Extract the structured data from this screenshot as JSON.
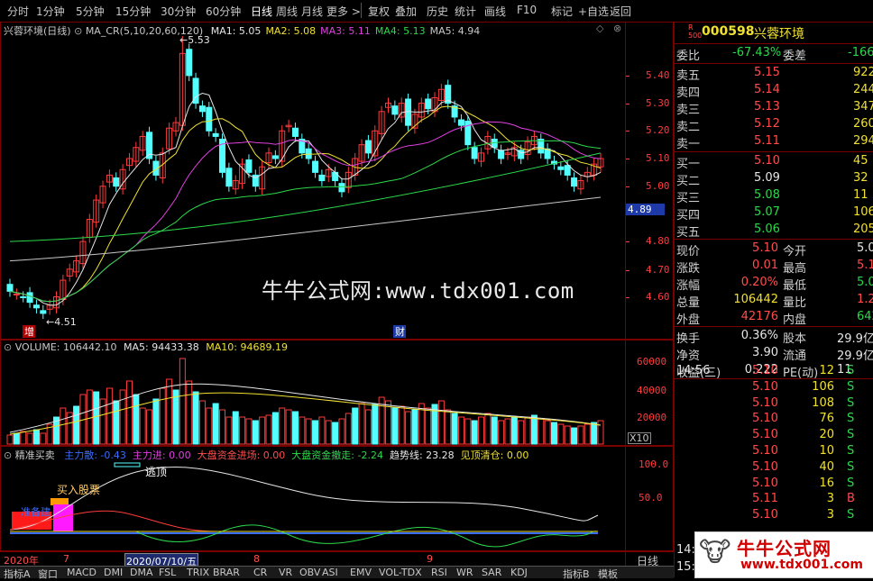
{
  "toolbar": {
    "periods": [
      "分时",
      "1分钟",
      "5分钟",
      "15分钟",
      "30分钟",
      "60分钟",
      "日线",
      "周线",
      "月线",
      "更多 >"
    ],
    "active_period": "日线",
    "actions": [
      "复权",
      "叠加",
      "历史",
      "统计",
      "画线",
      "F10",
      "标记",
      "+自选",
      "返回"
    ]
  },
  "kline": {
    "title": "兴蓉环境(日线)",
    "indicator": "MA_CR(5,10,20,60,120)",
    "ma": [
      {
        "label": "MA1:",
        "value": "5.05",
        "color": "#e6e6e6"
      },
      {
        "label": "MA2:",
        "value": "5.08",
        "color": "#f0e130"
      },
      {
        "label": "MA3:",
        "value": "5.11",
        "color": "#e040e0"
      },
      {
        "label": "MA4:",
        "value": "5.13",
        "color": "#2bd84a"
      },
      {
        "label": "MA5:",
        "value": "4.94",
        "color": "#c8c8c8"
      }
    ],
    "high_label": "5.53",
    "low_label": "4.51",
    "price_axis": [
      "5.40",
      "5.30",
      "5.20",
      "5.10",
      "5.00",
      "4.89",
      "4.80",
      "4.70",
      "4.60"
    ],
    "current_price_tag": "4.89",
    "markers": {
      "zeng": "增",
      "cai": "财"
    }
  },
  "volume": {
    "name": "VOLUME:",
    "value": "106442.10",
    "ma5_label": "MA5:",
    "ma5": "94433.38",
    "ma10_label": "MA10:",
    "ma10": "94689.19",
    "axis": [
      "60000",
      "40000",
      "20000"
    ],
    "unit": "X10"
  },
  "indicator": {
    "name": "精准买卖",
    "items": [
      {
        "label": "主力散:",
        "value": "-0.43",
        "color": "#3a6cff"
      },
      {
        "label": "主力进:",
        "value": "0.00",
        "color": "#e040e0"
      },
      {
        "label": "大盘资金进场:",
        "value": "0.00",
        "color": "#ff4d4d"
      },
      {
        "label": "大盘资金撤走:",
        "value": "-2.24",
        "color": "#2bd84a"
      },
      {
        "label": "趋势线:",
        "value": "23.28",
        "color": "#e6e6e6"
      },
      {
        "label": "见顶清仓:",
        "value": "0.00",
        "color": "#f0e130"
      }
    ],
    "axis": [
      "100.0",
      "50.0"
    ],
    "annotations": {
      "buy": "买入股票",
      "ready": "准备建",
      "escape": "逃顶"
    }
  },
  "date_axis": {
    "labels": [
      "2020年",
      "7",
      "2020/07/10/五",
      "8",
      "9"
    ],
    "period_tag": "日线"
  },
  "tabs": [
    "指标A",
    "窗口",
    "MACD",
    "DMI",
    "DMA",
    "FSL",
    "TRIX",
    "BRAR",
    "CR",
    "VR",
    "OBV",
    "ASI",
    "EMV",
    "VOL-TDX",
    "RSI",
    "WR",
    "SAR",
    "KDJ",
    "指标B",
    "模板"
  ],
  "watermark": "牛牛公式网:www.tdx001.com",
  "quote": {
    "code": "000598",
    "name": "兴蓉环境",
    "tag": "R\n500",
    "webi_label": "委比",
    "webi": "-67.43%",
    "weicha_label": "委差",
    "weicha": "-1666",
    "asks": [
      {
        "label": "卖五",
        "price": "5.15",
        "vol": "922"
      },
      {
        "label": "卖四",
        "price": "5.14",
        "vol": "244"
      },
      {
        "label": "卖三",
        "price": "5.13",
        "vol": "347"
      },
      {
        "label": "卖二",
        "price": "5.12",
        "vol": "260"
      },
      {
        "label": "卖一",
        "price": "5.11",
        "vol": "294"
      }
    ],
    "bids": [
      {
        "label": "买一",
        "price": "5.10",
        "vol": "45",
        "cls": "red"
      },
      {
        "label": "买二",
        "price": "5.09",
        "vol": "32",
        "cls": "wht"
      },
      {
        "label": "买三",
        "price": "5.08",
        "vol": "11",
        "cls": "grn"
      },
      {
        "label": "买四",
        "price": "5.07",
        "vol": "106",
        "cls": "grn"
      },
      {
        "label": "买五",
        "price": "5.06",
        "vol": "205",
        "cls": "grn"
      }
    ],
    "stats": [
      {
        "l1": "现价",
        "v1": "5.10",
        "c1": "red",
        "l2": "今开",
        "v2": "5.0",
        "c2": "wht"
      },
      {
        "l1": "涨跌",
        "v1": "0.01",
        "c1": "red",
        "l2": "最高",
        "v2": "5.1",
        "c2": "red"
      },
      {
        "l1": "涨幅",
        "v1": "0.20%",
        "c1": "red",
        "l2": "最低",
        "v2": "5.0",
        "c2": "grn"
      },
      {
        "l1": "总量",
        "v1": "106442",
        "c1": "yel",
        "l2": "量比",
        "v2": "1.2",
        "c2": "red"
      },
      {
        "l1": "外盘",
        "v1": "42176",
        "c1": "red",
        "l2": "内盘",
        "v2": "6426",
        "c2": "grn"
      }
    ],
    "stats2": [
      {
        "l1": "换手",
        "v1": "0.36%",
        "l2": "股本",
        "v2": "29.9亿"
      },
      {
        "l1": "净资",
        "v1": "3.90",
        "l2": "流通",
        "v2": "29.9亿"
      },
      {
        "l1": "收益(三)",
        "v1": "0.222",
        "l2": "PE(动)",
        "v2": "11"
      }
    ],
    "ticks": [
      {
        "time": "14:56",
        "price": "5.10",
        "vol": "12",
        "side": "S"
      },
      {
        "time": "",
        "price": "5.10",
        "vol": "106",
        "side": "S"
      },
      {
        "time": "",
        "price": "5.10",
        "vol": "108",
        "side": "S"
      },
      {
        "time": "",
        "price": "5.10",
        "vol": "76",
        "side": "S"
      },
      {
        "time": "",
        "price": "5.10",
        "vol": "20",
        "side": "S"
      },
      {
        "time": "",
        "price": "5.10",
        "vol": "10",
        "side": "S"
      },
      {
        "time": "",
        "price": "5.10",
        "vol": "40",
        "side": "S"
      },
      {
        "time": "",
        "price": "5.10",
        "vol": "16",
        "side": "S"
      },
      {
        "time": "",
        "price": "5.11",
        "vol": "3",
        "side": "B"
      },
      {
        "time": "",
        "price": "5.10",
        "vol": "3",
        "side": "S"
      }
    ],
    "tick_time_2": "14:5",
    "tick_time_3": "15:0"
  },
  "logo": {
    "text": "牛牛公式网",
    "url": "www.tdx001.com"
  }
}
